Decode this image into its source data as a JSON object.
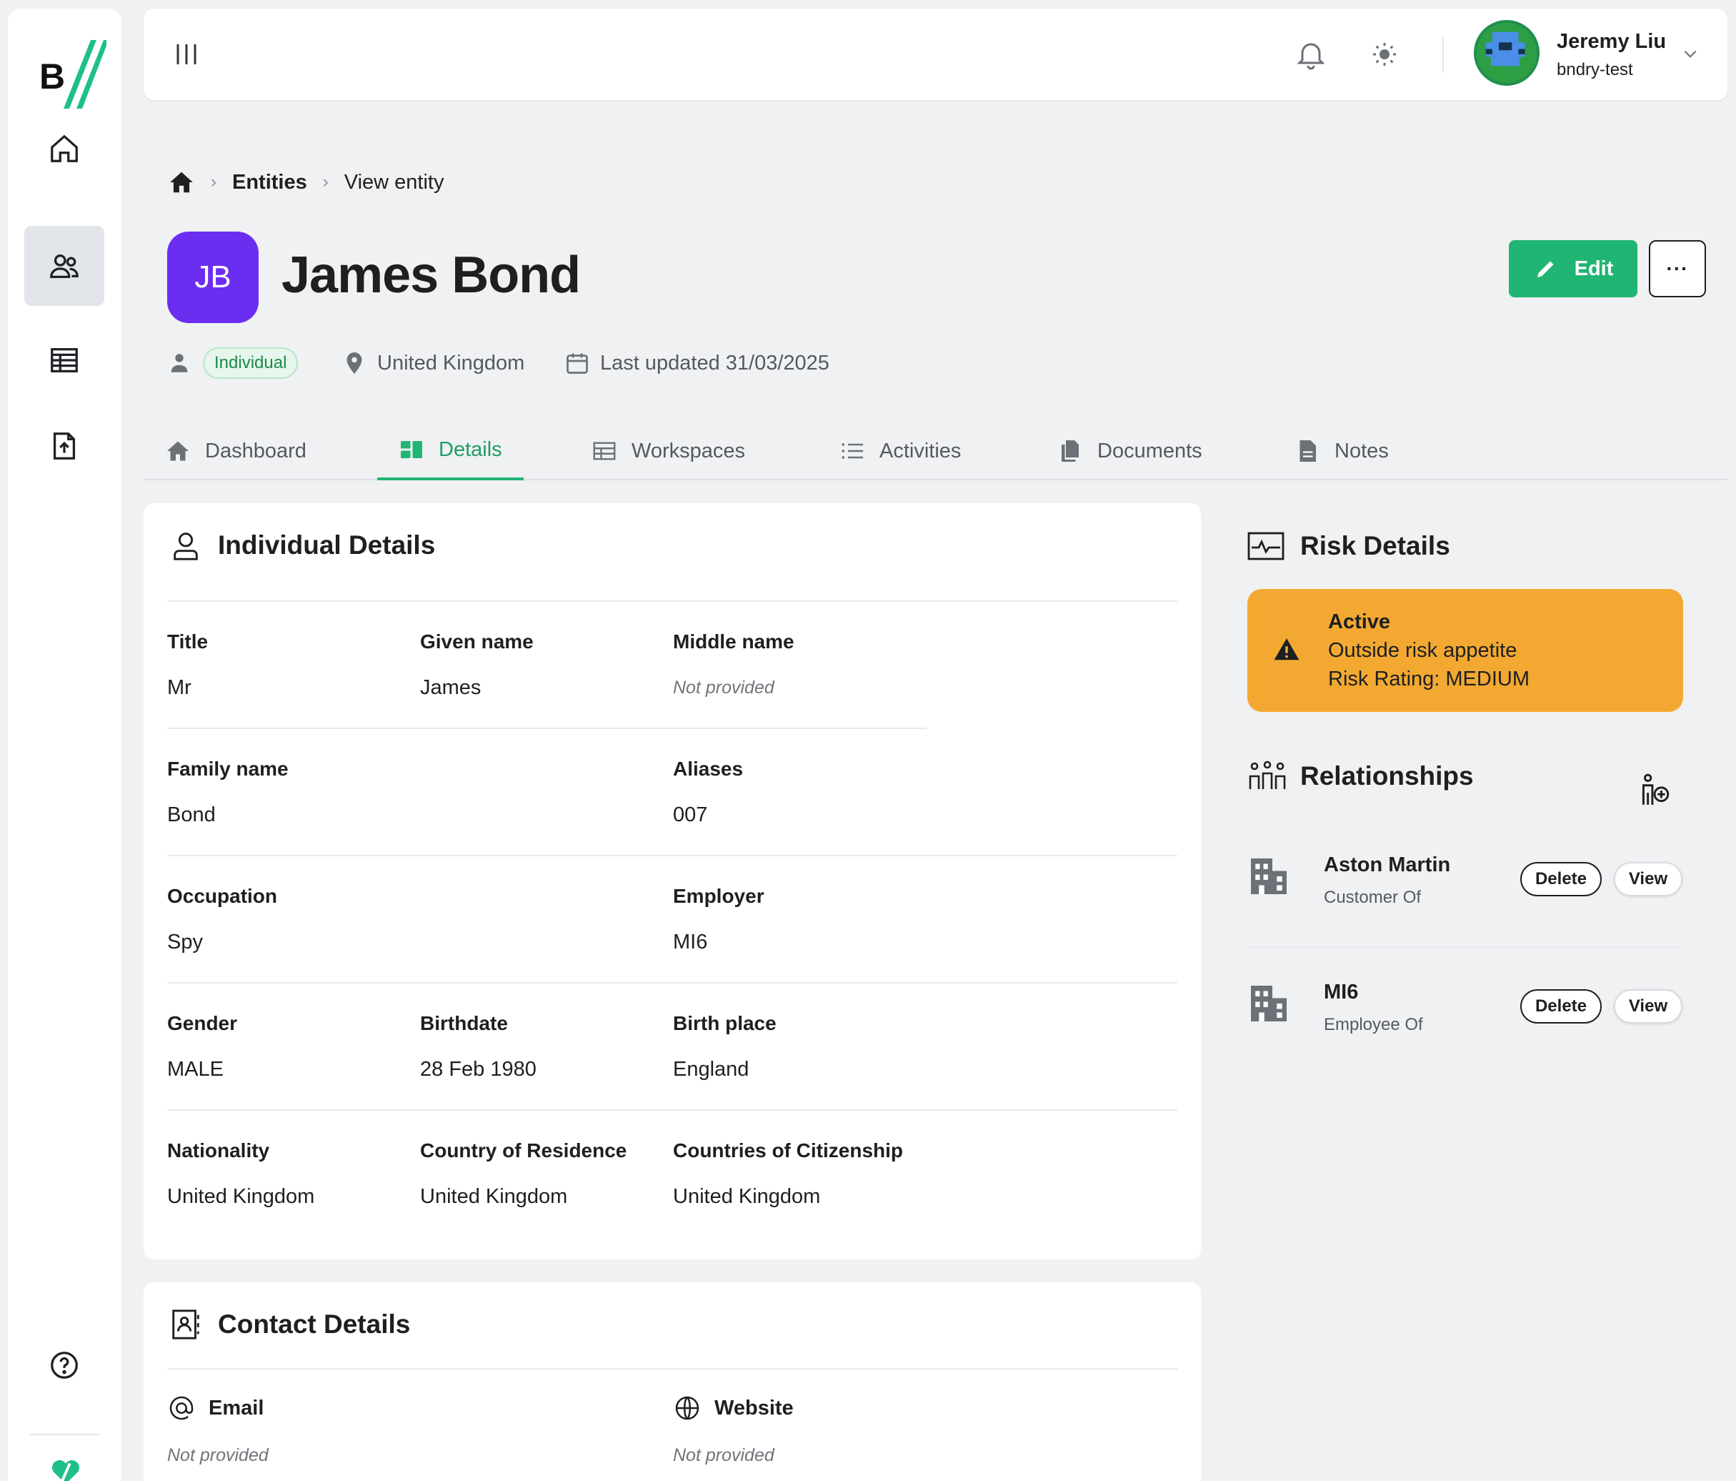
{
  "header": {
    "user_name": "Jeremy Liu",
    "user_org": "bndry-test"
  },
  "breadcrumb": {
    "section": "Entities",
    "current": "View entity"
  },
  "entity": {
    "initials": "JB",
    "name": "James Bond",
    "type_badge": "Individual",
    "country": "United Kingdom",
    "last_updated": "Last updated 31/03/2025"
  },
  "actions": {
    "edit_label": "Edit",
    "more_label": "···"
  },
  "tabs": [
    {
      "label": "Dashboard"
    },
    {
      "label": "Details"
    },
    {
      "label": "Workspaces"
    },
    {
      "label": "Activities"
    },
    {
      "label": "Documents"
    },
    {
      "label": "Notes"
    }
  ],
  "individual_details": {
    "title": "Individual Details",
    "fields": {
      "title_label": "Title",
      "title_value": "Mr",
      "given_label": "Given name",
      "given_value": "James",
      "middle_label": "Middle name",
      "middle_value": "Not provided",
      "family_label": "Family name",
      "family_value": "Bond",
      "aliases_label": "Aliases",
      "aliases_value": "007",
      "occupation_label": "Occupation",
      "occupation_value": "Spy",
      "employer_label": "Employer",
      "employer_value": "MI6",
      "gender_label": "Gender",
      "gender_value": "MALE",
      "birthdate_label": "Birthdate",
      "birthdate_value": "28 Feb 1980",
      "birthplace_label": "Birth place",
      "birthplace_value": "England",
      "nationality_label": "Nationality",
      "nationality_value": "United Kingdom",
      "residence_label": "Country of Residence",
      "residence_value": "United Kingdom",
      "citizenship_label": "Countries of Citizenship",
      "citizenship_value": "United Kingdom"
    }
  },
  "contact_details": {
    "title": "Contact Details",
    "email_label": "Email",
    "email_value": "Not provided",
    "website_label": "Website",
    "website_value": "Not provided"
  },
  "risk": {
    "title": "Risk Details",
    "status": "Active",
    "appetite": "Outside risk appetite",
    "rating": "Risk Rating: MEDIUM"
  },
  "relationships": {
    "title": "Relationships",
    "items": [
      {
        "name": "Aston Martin",
        "role": "Customer Of",
        "delete_label": "Delete",
        "view_label": "View"
      },
      {
        "name": "MI6",
        "role": "Employee Of",
        "delete_label": "Delete",
        "view_label": "View"
      }
    ]
  },
  "colors": {
    "accent": "#21b573",
    "avatar": "#6b2ef0",
    "risk_medium": "#f3a931",
    "background": "#eff1f3"
  },
  "icons": [
    "home-icon",
    "users-icon",
    "table-icon",
    "file-upload-icon",
    "help-icon",
    "bell-icon",
    "sun-icon",
    "menu-icon",
    "chevron-down-icon",
    "map-pin-icon",
    "calendar-icon",
    "person-icon",
    "warning-icon",
    "building-icon",
    "add-person-icon",
    "activity-icon",
    "at-icon",
    "globe-icon",
    "contact-card-icon",
    "pencil-icon"
  ]
}
